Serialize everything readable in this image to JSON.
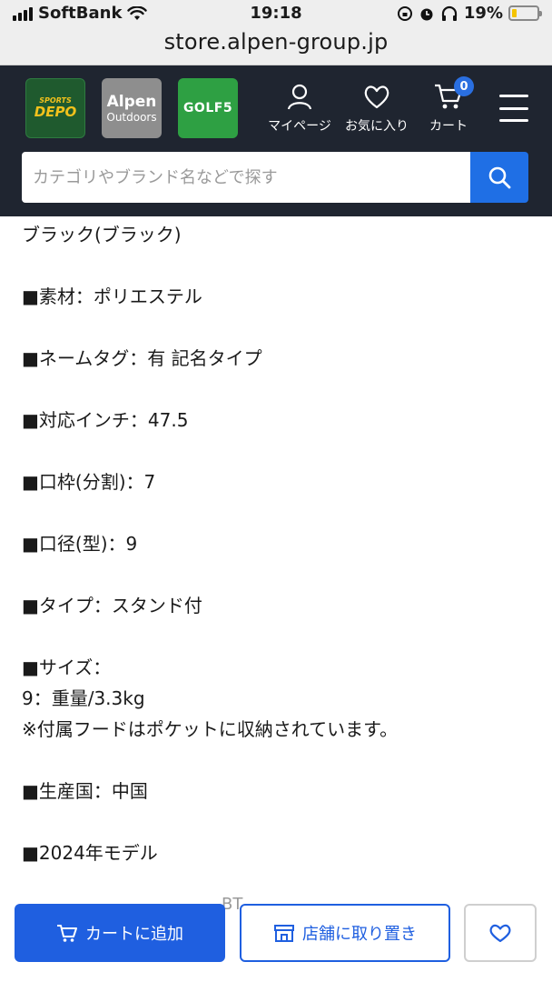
{
  "status_bar": {
    "carrier": "SoftBank",
    "time": "19:18",
    "battery_percent": "19%",
    "battery_level": 0.19,
    "url": "store.alpen-group.jp"
  },
  "header": {
    "logos": {
      "depo_small": "SPORTS",
      "depo_big": "DEPO",
      "alpen_big": "Alpen",
      "alpen_small": "Outdoors",
      "golf": "GOLF5"
    },
    "nav": {
      "mypage": "マイページ",
      "favorites": "お気に入り",
      "cart": "カート",
      "cart_count": "0"
    },
    "search": {
      "placeholder": "カテゴリやブランド名などで探す"
    }
  },
  "specs": [
    "ブラック(ブラック)",
    "■素材：ポリエステル",
    "■ネームタグ：有 記名タイプ",
    "■対応インチ：47.5",
    "■口枠(分割)：7",
    "■口径(型)：9",
    "■タイプ：スタンド付",
    "■サイズ：",
    "9：重量/3.3kg",
    "※付属フードはポケットに収納されています。",
    "■生産国：中国",
    "■2024年モデル"
  ],
  "bottom_bar": {
    "ghost_text": "BT",
    "add_to_cart": "カートに追加",
    "reserve_in_store": "店舗に取り置き"
  },
  "colors": {
    "header_bg": "#1f2530",
    "primary_blue": "#1f5fe0",
    "depo_green": "#1f5a2e",
    "golf_green": "#2ea043"
  }
}
